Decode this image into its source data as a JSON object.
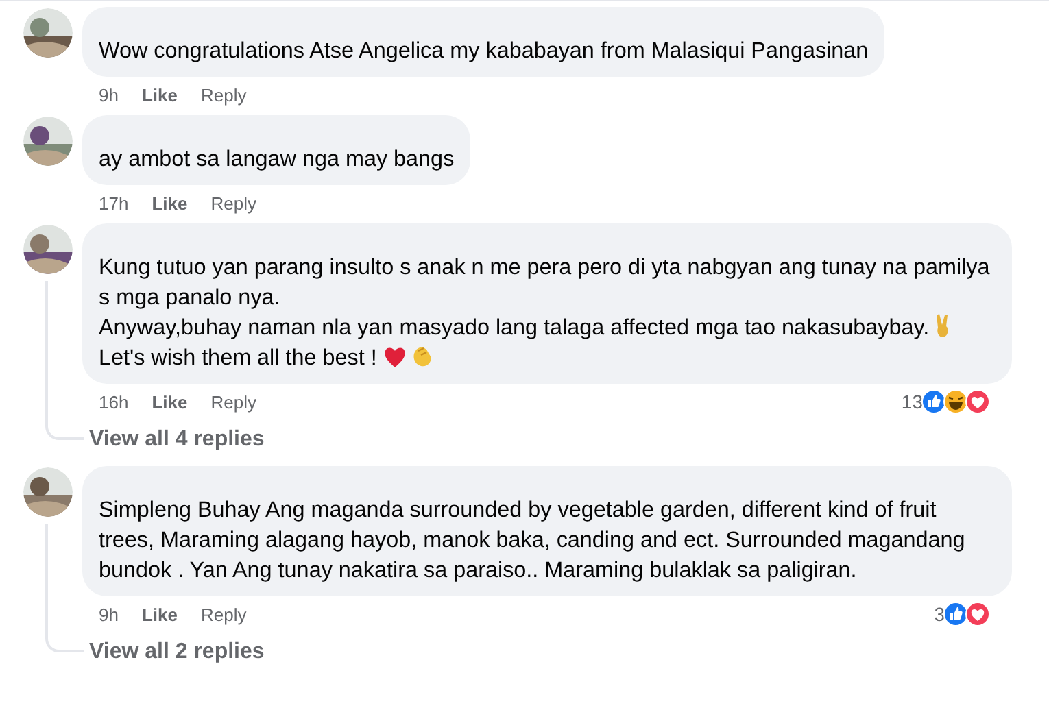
{
  "comments": [
    {
      "paragraphs": [
        {
          "text": "Wow congratulations Atse Angelica my kababayan from Malasiqui Pangasinan"
        }
      ],
      "time": "9h",
      "like": "Like",
      "reply": "Reply"
    },
    {
      "paragraphs": [
        {
          "text": "ay ambot sa langaw nga may bangs"
        }
      ],
      "time": "17h",
      "like": "Like",
      "reply": "Reply"
    },
    {
      "paragraphs": [
        {
          "text": "Kung tutuo yan parang insulto s anak n me pera pero di yta nabgyan ang tunay na pamilya s mga panalo nya."
        },
        {
          "text": "Anyway,buhay naman nla yan masyado lang talaga affected mga tao nakasubaybay.",
          "emoji": [
            {
              "kind": "victory"
            }
          ]
        },
        {
          "text": "Let's wish them all the best !",
          "emoji": [
            {
              "kind": "heart"
            },
            {
              "kind": "clap"
            }
          ]
        }
      ],
      "time": "16h",
      "like": "Like",
      "reply": "Reply",
      "reactions": {
        "count": "13",
        "types": [
          {
            "kind": "like"
          },
          {
            "kind": "haha"
          },
          {
            "kind": "love"
          }
        ]
      },
      "view_replies": "View all 4 replies"
    },
    {
      "paragraphs": [
        {
          "text": "Simpleng Buhay Ang maganda surrounded by vegetable garden, different kind of fruit trees, Maraming alagang hayob, manok baka, canding and ect. Surrounded magandang bundok . Yan Ang tunay nakatira sa paraiso.. Maraming bulaklak sa paligiran."
        }
      ],
      "time": "9h",
      "like": "Like",
      "reply": "Reply",
      "reactions": {
        "count": "3",
        "types": [
          {
            "kind": "like"
          },
          {
            "kind": "love"
          }
        ]
      },
      "view_replies": "View all 2 replies"
    }
  ]
}
